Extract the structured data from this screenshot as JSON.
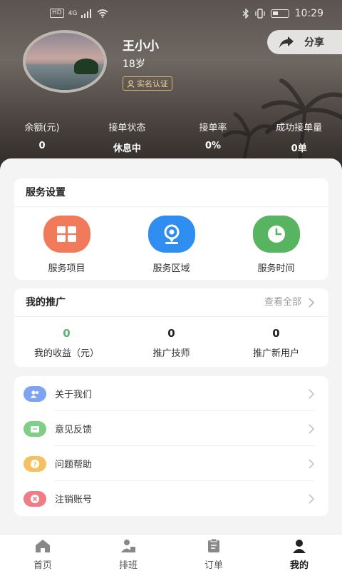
{
  "status_bar": {
    "network": "4G",
    "hd": "HD",
    "time": "10:29"
  },
  "profile": {
    "name": "王小小",
    "age": "18岁",
    "verify_label": "实名认证",
    "share_label": "分享"
  },
  "stats": [
    {
      "label": "余额(元)",
      "value": "0"
    },
    {
      "label": "接单状态",
      "value": "休息中"
    },
    {
      "label": "接单率",
      "value": "0%"
    },
    {
      "label": "成功接单量",
      "value": "0单"
    }
  ],
  "service_settings": {
    "title": "服务设置",
    "items": [
      {
        "label": "服务项目",
        "icon": "grid-icon",
        "color": "#f07a5a"
      },
      {
        "label": "服务区域",
        "icon": "location-pin-icon",
        "color": "#2f8ef0"
      },
      {
        "label": "服务时间",
        "icon": "clock-icon",
        "color": "#57b461"
      }
    ]
  },
  "promotion": {
    "title": "我的推广",
    "more_label": "查看全部",
    "items": [
      {
        "value": "0",
        "label": "我的收益（元）"
      },
      {
        "value": "0",
        "label": "推广技师"
      },
      {
        "value": "0",
        "label": "推广新用户"
      }
    ]
  },
  "menu": [
    {
      "label": "关于我们",
      "icon": "users-icon",
      "color": "#7ea3f3"
    },
    {
      "label": "意见反馈",
      "icon": "feedback-icon",
      "color": "#7fcf86"
    },
    {
      "label": "问题帮助",
      "icon": "help-icon",
      "color": "#f5c160"
    },
    {
      "label": "注销账号",
      "icon": "cancel-icon",
      "color": "#ef7d86"
    }
  ],
  "bottom_nav": [
    {
      "label": "首页",
      "icon": "home-icon"
    },
    {
      "label": "排班",
      "icon": "schedule-icon"
    },
    {
      "label": "订单",
      "icon": "order-icon"
    },
    {
      "label": "我的",
      "icon": "profile-icon",
      "active": true
    }
  ]
}
